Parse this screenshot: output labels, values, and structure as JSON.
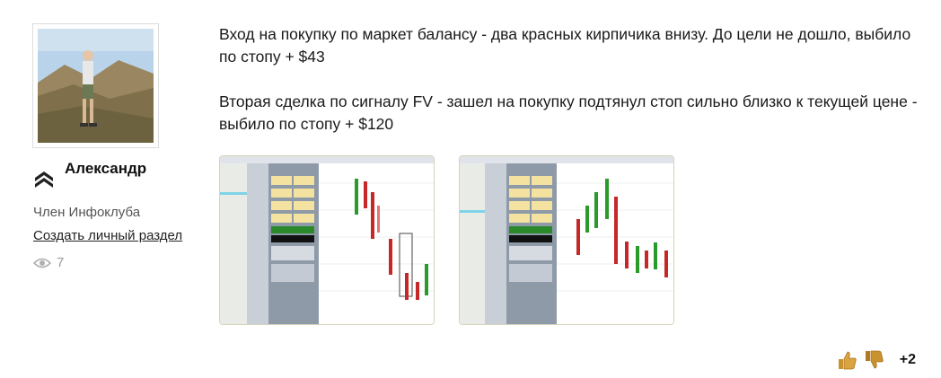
{
  "author": {
    "name": "Александр",
    "role": "Член Инфоклуба",
    "link_label": "Создать личный раздел",
    "views": "7"
  },
  "post": {
    "paragraphs": [
      "Вход на покупку по маркет балансу - два красных кирпичика внизу. До цели не дошло, выбило по стопу + $43",
      "Вторая сделка по сигналу FV - зашел на покупку подтянул стоп сильно близко к текущей цене - выбило по стопу + $120"
    ]
  },
  "rating": {
    "score": "+2"
  },
  "icons": {
    "rank": "chevron-rank-icon",
    "views": "eye-icon",
    "like": "thumbs-up-icon",
    "dislike": "thumbs-down-icon"
  },
  "colors": {
    "like": "#d9a441",
    "dislike": "#c8922e",
    "rank": "#222222"
  }
}
